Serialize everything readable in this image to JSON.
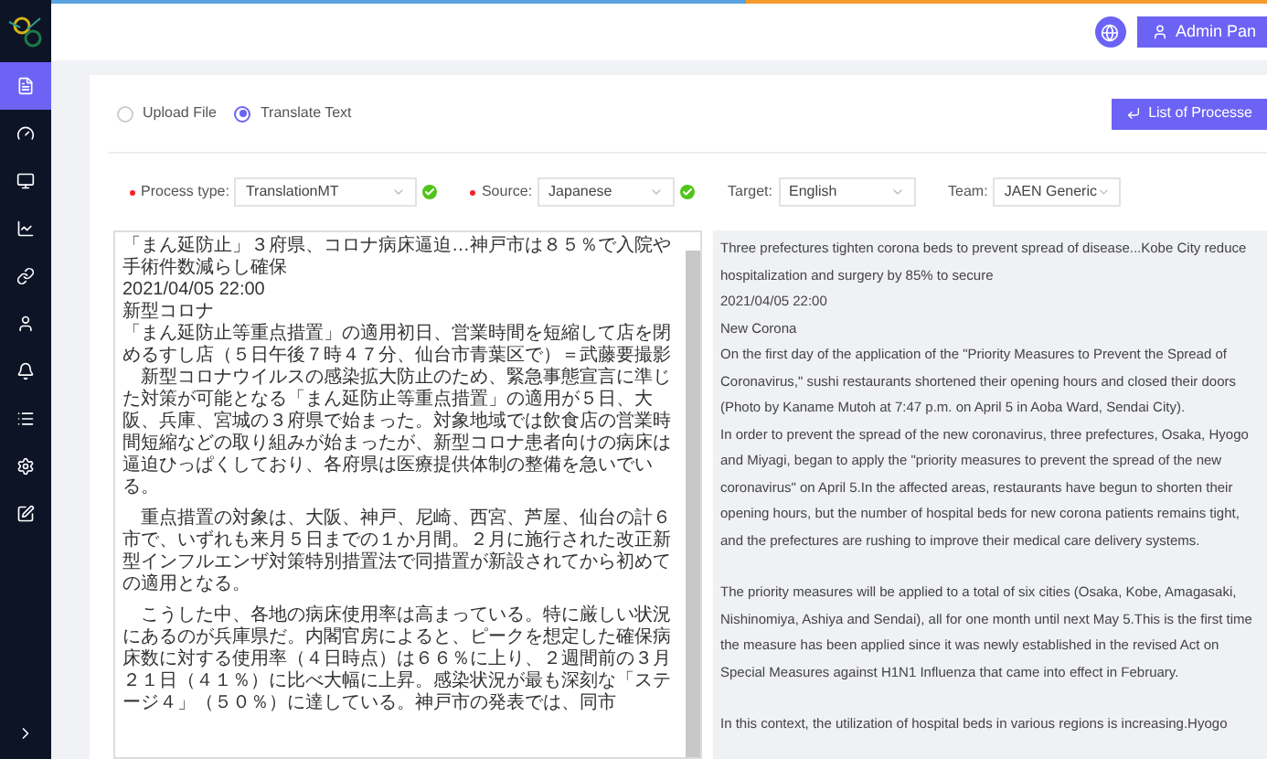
{
  "sidebar": {
    "items": [
      {
        "selected": true
      },
      {
        "selected": false
      },
      {
        "selected": false
      },
      {
        "selected": false
      },
      {
        "selected": false
      },
      {
        "selected": false
      },
      {
        "selected": false
      },
      {
        "selected": false
      },
      {
        "selected": false
      },
      {
        "selected": false
      }
    ]
  },
  "header": {
    "user_button": "Admin Pan"
  },
  "mode": [
    {
      "label": "Upload File",
      "selected": false
    },
    {
      "label": "Translate Text",
      "selected": true
    }
  ],
  "list_button": "List of Processe",
  "fields": [
    {
      "label": "Process type:",
      "required": true,
      "value": "TranslationMT",
      "valid": true
    },
    {
      "label": "Source:",
      "required": true,
      "value": "Japanese",
      "valid": true
    },
    {
      "label": "Target:",
      "required": false,
      "value": "English",
      "valid": false
    },
    {
      "label": "Team:",
      "required": false,
      "value": "JAEN Generic",
      "valid": false
    }
  ],
  "source_text": [
    "「まん延防止」３府県、コロナ病床逼迫…神戸市は８５％で入院や手術件数減らし確保",
    "2021/04/05 22:00",
    "新型コロナ",
    "「まん延防止等重点措置」の適用初日、営業時間を短縮して店を閉めるすし店（５日午後７時４７分、仙台市青葉区で）＝武藤要撮影",
    "　新型コロナウイルスの感染拡大防止のため、緊急事態宣言に準じた対策が可能となる「まん延防止等重点措置」の適用が５日、大阪、兵庫、宮城の３府県で始まった。対象地域では飲食店の営業時間短縮などの取り組みが始まったが、新型コロナ患者向けの病床は逼迫ひっぱくしており、各府県は医療提供体制の整備を急いでいる。",
    "　重点措置の対象は、大阪、神戸、尼崎、西宮、芦屋、仙台の計６市で、いずれも来月５日までの１か月間。２月に施行された改正新型インフルエンザ対策特別措置法で同措置が新設されてから初めての適用となる。",
    "　こうした中、各地の病床使用率は高まっている。特に厳しい状況にあるのが兵庫県だ。内閣官房によると、ピークを想定した確保病床数に対する使用率（４日時点）は６６％に上り、２週間前の３月２１日（４１％）に比べ大幅に上昇。感染状況が最も深刻な「ステージ４」（５０％）に達している。神戸市の発表では、同市"
  ],
  "target_text": [
    "Three prefectures tighten corona beds to prevent spread of disease...Kobe City reduce hospitalization and surgery by 85% to secure",
    "2021/04/05 22:00",
    "New Corona",
    "On the first day of the application of the \"Priority Measures to Prevent the Spread of Coronavirus,\" sushi restaurants shortened their opening hours and closed their doors (Photo by Kaname Mutoh at 7:47 p.m. on April 5 in Aoba Ward, Sendai City).",
    "   In order to prevent the spread of the new coronavirus, three prefectures, Osaka, Hyogo and Miyagi, began to apply the \"priority measures to prevent the spread of the new coronavirus\" on April 5.In the affected areas, restaurants have begun to shorten their opening hours, but the number of hospital beds for new corona patients remains tight, and the prefectures are rushing to improve their medical care delivery systems.",
    "   The priority measures will be applied to a total of six cities (Osaka, Kobe, Amagasaki, Nishinomiya, Ashiya and Sendai), all for one month until next May 5.This is the first time the measure has been applied since it was newly established in the revised Act on Special Measures against H1N1 Influenza that came into effect in February.",
    "   In this context, the utilization of hospital beds in various regions is increasing.Hyogo"
  ]
}
